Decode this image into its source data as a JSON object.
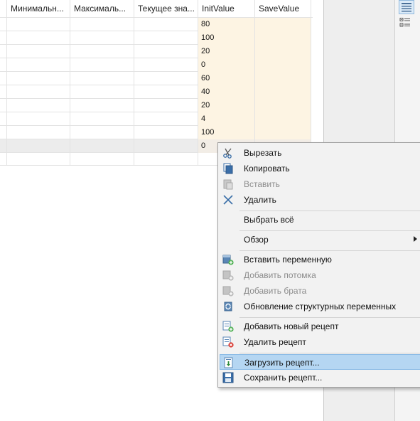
{
  "grid": {
    "columns": [
      "Минимальн...",
      "Максималь...",
      "Текущее зна...",
      "InitValue",
      "SaveValue"
    ],
    "init_values": [
      "80",
      "100",
      "20",
      "0",
      "60",
      "40",
      "20",
      "4",
      "100",
      "0"
    ]
  },
  "menu": {
    "items": [
      {
        "label": "Вырезать",
        "icon": "scissors-icon"
      },
      {
        "label": "Копировать",
        "icon": "copy-icon"
      },
      {
        "label": "Вставить",
        "icon": "paste-icon"
      },
      {
        "label": "Удалить",
        "icon": "delete-x-icon"
      },
      {
        "label": "Выбрать всё"
      },
      {
        "label": "Обзор"
      },
      {
        "label": "Вставить переменную",
        "icon": "insert-variable-icon"
      },
      {
        "label": "Добавить потомка",
        "icon": "add-child-icon"
      },
      {
        "label": "Добавить брата",
        "icon": "add-sibling-icon"
      },
      {
        "label": "Обновление структурных переменных",
        "icon": "refresh-structure-icon"
      },
      {
        "label": "Добавить новый рецепт",
        "icon": "add-recipe-icon"
      },
      {
        "label": "Удалить рецепт",
        "icon": "delete-recipe-icon"
      },
      {
        "label": "Загрузить рецепт...",
        "icon": "load-recipe-icon"
      },
      {
        "label": "Сохранить рецепт...",
        "icon": "save-recipe-icon"
      }
    ]
  },
  "colors": {
    "value_cells": "#fdf4e3",
    "menu_highlight": "#b5d6f2",
    "delete_x": "#3a6ea8"
  }
}
